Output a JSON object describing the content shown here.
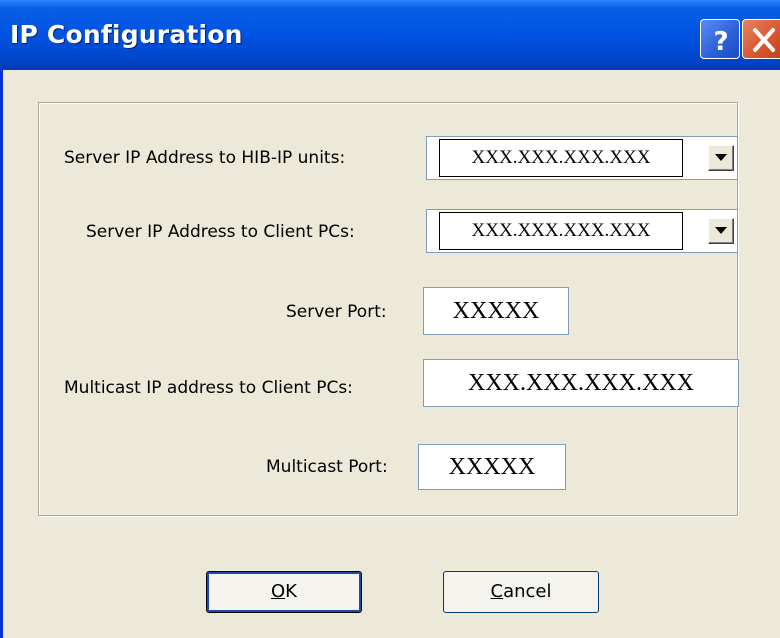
{
  "window": {
    "title": "IP Configuration"
  },
  "titlebar_buttons": {
    "help": "?",
    "close": "X"
  },
  "form": {
    "server_ip_hib": {
      "label": "Server IP Address to HIB-IP units:",
      "value": "XXX.XXX.XXX.XXX"
    },
    "server_ip_client": {
      "label": "Server IP Address to Client PCs:",
      "value": "XXX.XXX.XXX.XXX"
    },
    "server_port": {
      "label": "Server Port:",
      "value": "XXXXX"
    },
    "multicast_ip": {
      "label": "Multicast IP address to Client PCs:",
      "value": "XXX.XXX.XXX.XXX"
    },
    "multicast_port": {
      "label": "Multicast Port:",
      "value": "XXXXX"
    }
  },
  "buttons": {
    "ok": {
      "mnemonic": "O",
      "rest": "K"
    },
    "cancel": {
      "mnemonic": "C",
      "rest": "ancel"
    }
  },
  "colors": {
    "titlebar": "#0054e3",
    "dialog_bg": "#ece9d8",
    "close_button": "#d7552d",
    "field_border": "#7f9db9"
  }
}
